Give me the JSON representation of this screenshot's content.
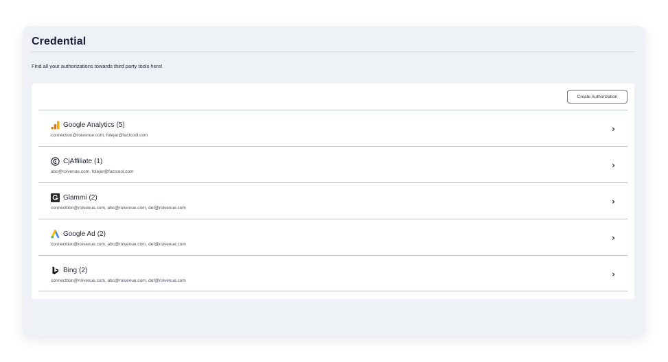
{
  "page": {
    "title": "Credential",
    "subtitle": "Find all your authorizations towards third party tools here!",
    "create_button_label": "Create Authorization"
  },
  "authorizations": [
    {
      "name": "Google Analytics",
      "count": "(5)",
      "accounts": "connection@roivenue.com, folejar@factcool.com",
      "icon": "google-analytics-icon",
      "chevron": "›"
    },
    {
      "name": "CjAffiliate",
      "count": "(1)",
      "accounts": "abc@roivenue.com, folejar@factcool.com",
      "icon": "cj-affiliate-icon",
      "chevron": "›"
    },
    {
      "name": "Glammi",
      "count": "(2)",
      "accounts": "connecttion@roivenue.com, abc@roivenue.com, def@roivenue.com",
      "icon": "glammi-icon",
      "chevron": "›"
    },
    {
      "name": "Google Ad",
      "count": "(2)",
      "accounts": "connecttion@roivenue.com, abc@roivenue.com, def@roivenue.com",
      "icon": "google-ads-icon",
      "chevron": "›"
    },
    {
      "name": "Bing",
      "count": "(2)",
      "accounts": "connecttion@roivenue.com, abc@roivenue.com, def@roivenue.com",
      "icon": "bing-icon",
      "chevron": "›"
    }
  ],
  "colors": {
    "panel_bg": "#eef1f5",
    "title": "#1b1f3b",
    "analytics_orange": "#f9ab00",
    "analytics_dark": "#e37400",
    "ads_blue": "#4285f4",
    "ads_yellow": "#fbbc04",
    "ads_green": "#34a853"
  }
}
